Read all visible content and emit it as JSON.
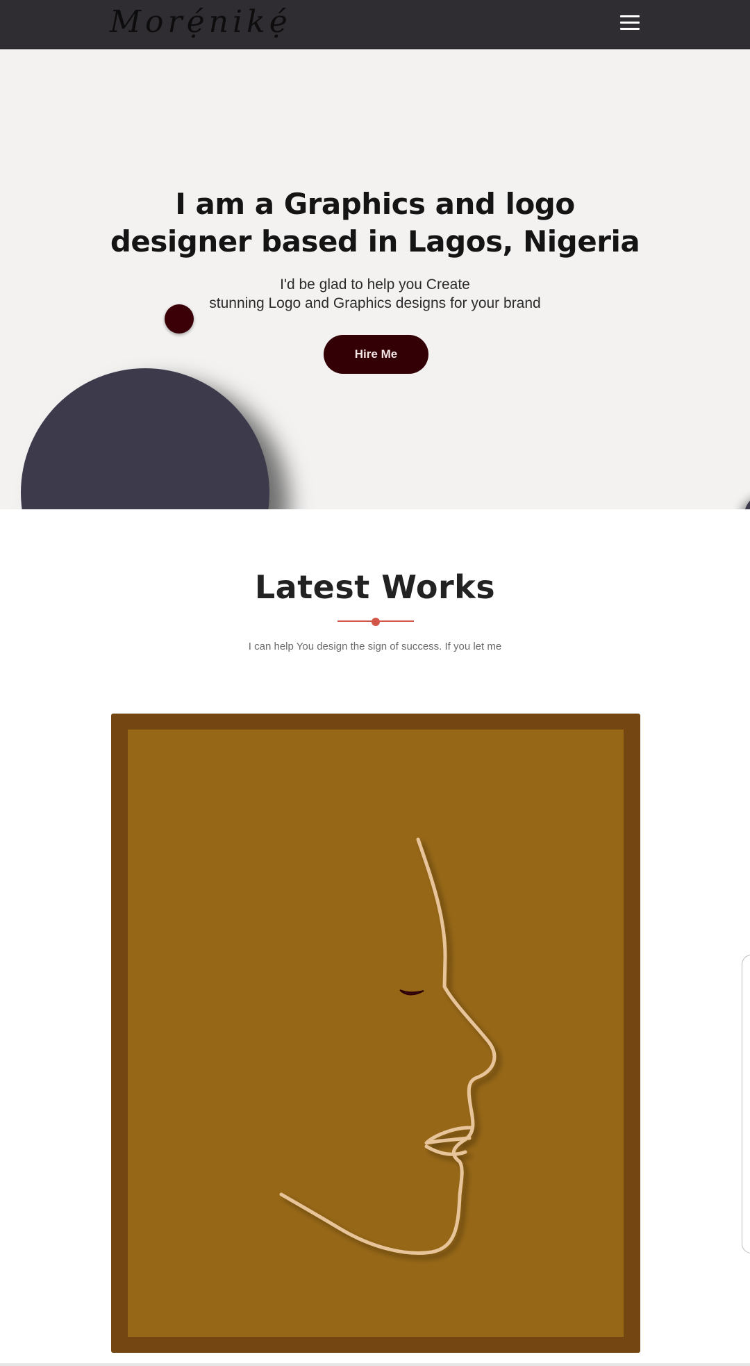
{
  "header": {
    "logo_text": "Morẹ́nikẹ́",
    "menu_icon": "hamburger-menu-icon"
  },
  "hero": {
    "title_line1": "I am a Graphics and logo",
    "title_line2": "designer based in Lagos, Nigeria",
    "subtitle_line1": "I'd be glad to help you Create",
    "subtitle_line2": "stunning Logo and Graphics designs for your brand",
    "hire_button": "Hire Me"
  },
  "works": {
    "title": "Latest Works",
    "subtitle": "I can help You design the sign of success. If you let me"
  },
  "colors": {
    "header_bg": "#302d32",
    "hero_bg": "#f3f2f1",
    "button_bg": "#330005",
    "accent": "#d2574a",
    "circle": "#3d3a4c",
    "frame": "#744612",
    "art_bg": "#966717",
    "line_art": "#e8c49a"
  }
}
